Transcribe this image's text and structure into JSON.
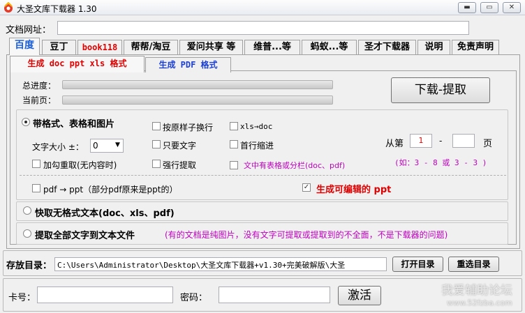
{
  "window": {
    "title": "大圣文库下载器 1.30",
    "min_label": "▬",
    "max_label": "▭",
    "close_label": "✕"
  },
  "url_label": "文档网址：",
  "tabs": [
    "百度",
    "豆丁",
    "book118",
    "帮帮/淘豆",
    "爱问共享 等",
    "维普...等",
    "蚂蚁...等",
    "圣才下载器",
    "说明",
    "免责声明"
  ],
  "subtabs": [
    "生成 doc ppt xls 格式",
    "生成 PDF 格式"
  ],
  "progress": {
    "total_label": "总进度：",
    "current_label": "当前页：",
    "total_value": 0,
    "current_value": 0
  },
  "download_button": "下载-提取",
  "options": {
    "radio1": "带格式、表格和图片",
    "keep_linebreak": "按原样子换行",
    "xls_doc": "xls→doc",
    "font_size_label": "文字大小 ±：",
    "font_size_value": "0",
    "text_only": "只要文字",
    "first_indent": "首行缩进",
    "recheck": "加勾重取(无内容时)",
    "force_extract": "强行提取",
    "table_note": "文中有表格或分栏(doc、pdf)",
    "page_from": "从第",
    "page_from_value": "1",
    "page_dash": "-",
    "page_to_value": "",
    "page_unit": "页",
    "page_hint": "(如：3 - 8  或 3 - 3 )",
    "pdf_ppt": "pdf → ppt（部分pdf原来是ppt的）",
    "editable_ppt": "生成可编辑的 ppt",
    "editable_checked": "✓",
    "radio2": "快取无格式文本(doc、xls、pdf)",
    "radio3": "提取全部文字到文本文件",
    "radio3_note": "(有的文档是纯图片，没有文字可提取或提取到的不全面，不是下载器的问题)"
  },
  "save": {
    "label": "存放目录：",
    "path": "C:\\Users\\Administrator\\Desktop\\大圣文库下载器+v1.30+完美破解版\\大圣",
    "open_button": "打开目录",
    "reselect_button": "重选目录"
  },
  "activation": {
    "card_label": "卡号：",
    "password_label": "密码：",
    "activate_button": "激活"
  },
  "watermark": {
    "line1": "我爱辅助论坛",
    "line2": "www.52fzba.com"
  }
}
